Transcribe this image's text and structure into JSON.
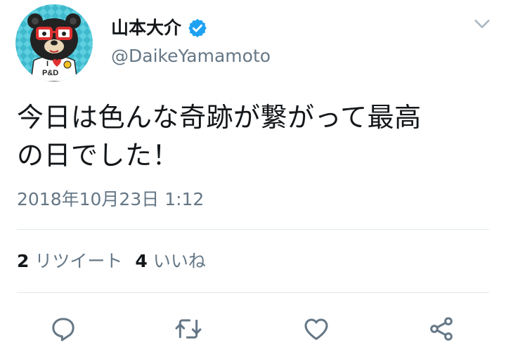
{
  "author": {
    "display_name": "山本大介",
    "handle": "@DaikeYamamoto",
    "verified": true,
    "avatar_icon": "bear-avatar-icon",
    "avatar_shirt_text_top": "I",
    "avatar_shirt_text_bottom": "P&D"
  },
  "tweet": {
    "text": "今日は色んな奇跡が繋がって最高\nの日でした！",
    "timestamp": "2018年10月23日 1:12"
  },
  "stats": {
    "retweets_count": "2",
    "retweets_label": "リツイート",
    "likes_count": "4",
    "likes_label": "いいね"
  },
  "actions": {
    "reply_icon": "reply-icon",
    "retweet_icon": "retweet-icon",
    "like_icon": "heart-icon",
    "share_icon": "share-icon"
  },
  "colors": {
    "primary_text": "#14171a",
    "secondary_text": "#657786",
    "divider": "#e1e8ed",
    "verified_blue": "#1da1f2",
    "icon_gray": "#657786",
    "avatar_bg": "#49c7d8"
  }
}
